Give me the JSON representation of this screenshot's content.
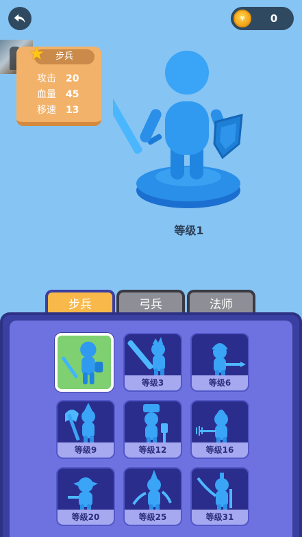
{
  "header": {
    "coins": "0",
    "coin_symbol": "¥"
  },
  "stats": {
    "unit_name": "步兵",
    "rows": [
      {
        "label": "攻击",
        "value": "20"
      },
      {
        "label": "血量",
        "value": "45"
      },
      {
        "label": "移速",
        "value": "13"
      }
    ]
  },
  "hero": {
    "level_label": "等级1"
  },
  "tabs": [
    {
      "label": "步兵",
      "active": true
    },
    {
      "label": "弓兵",
      "active": false
    },
    {
      "label": "法师",
      "active": false
    }
  ],
  "units": [
    {
      "level": "",
      "weapon": "sword-shield",
      "selected": true
    },
    {
      "level": "等级3",
      "weapon": "big-sword"
    },
    {
      "level": "等级6",
      "weapon": "spear-helmet"
    },
    {
      "level": "等级9",
      "weapon": "axe"
    },
    {
      "level": "等级12",
      "weapon": "hammer"
    },
    {
      "level": "等级16",
      "weapon": "trident"
    },
    {
      "level": "等级20",
      "weapon": "goblin-bow"
    },
    {
      "level": "等级25",
      "weapon": "scimitar"
    },
    {
      "level": "等级31",
      "weapon": "katana"
    }
  ],
  "colors": {
    "sky": "#86c4f3",
    "hero_blue": "#2a8fe8",
    "panel": "#6e72e0",
    "tab_active": "#f8b84a",
    "selected_card": "#7ed070"
  }
}
